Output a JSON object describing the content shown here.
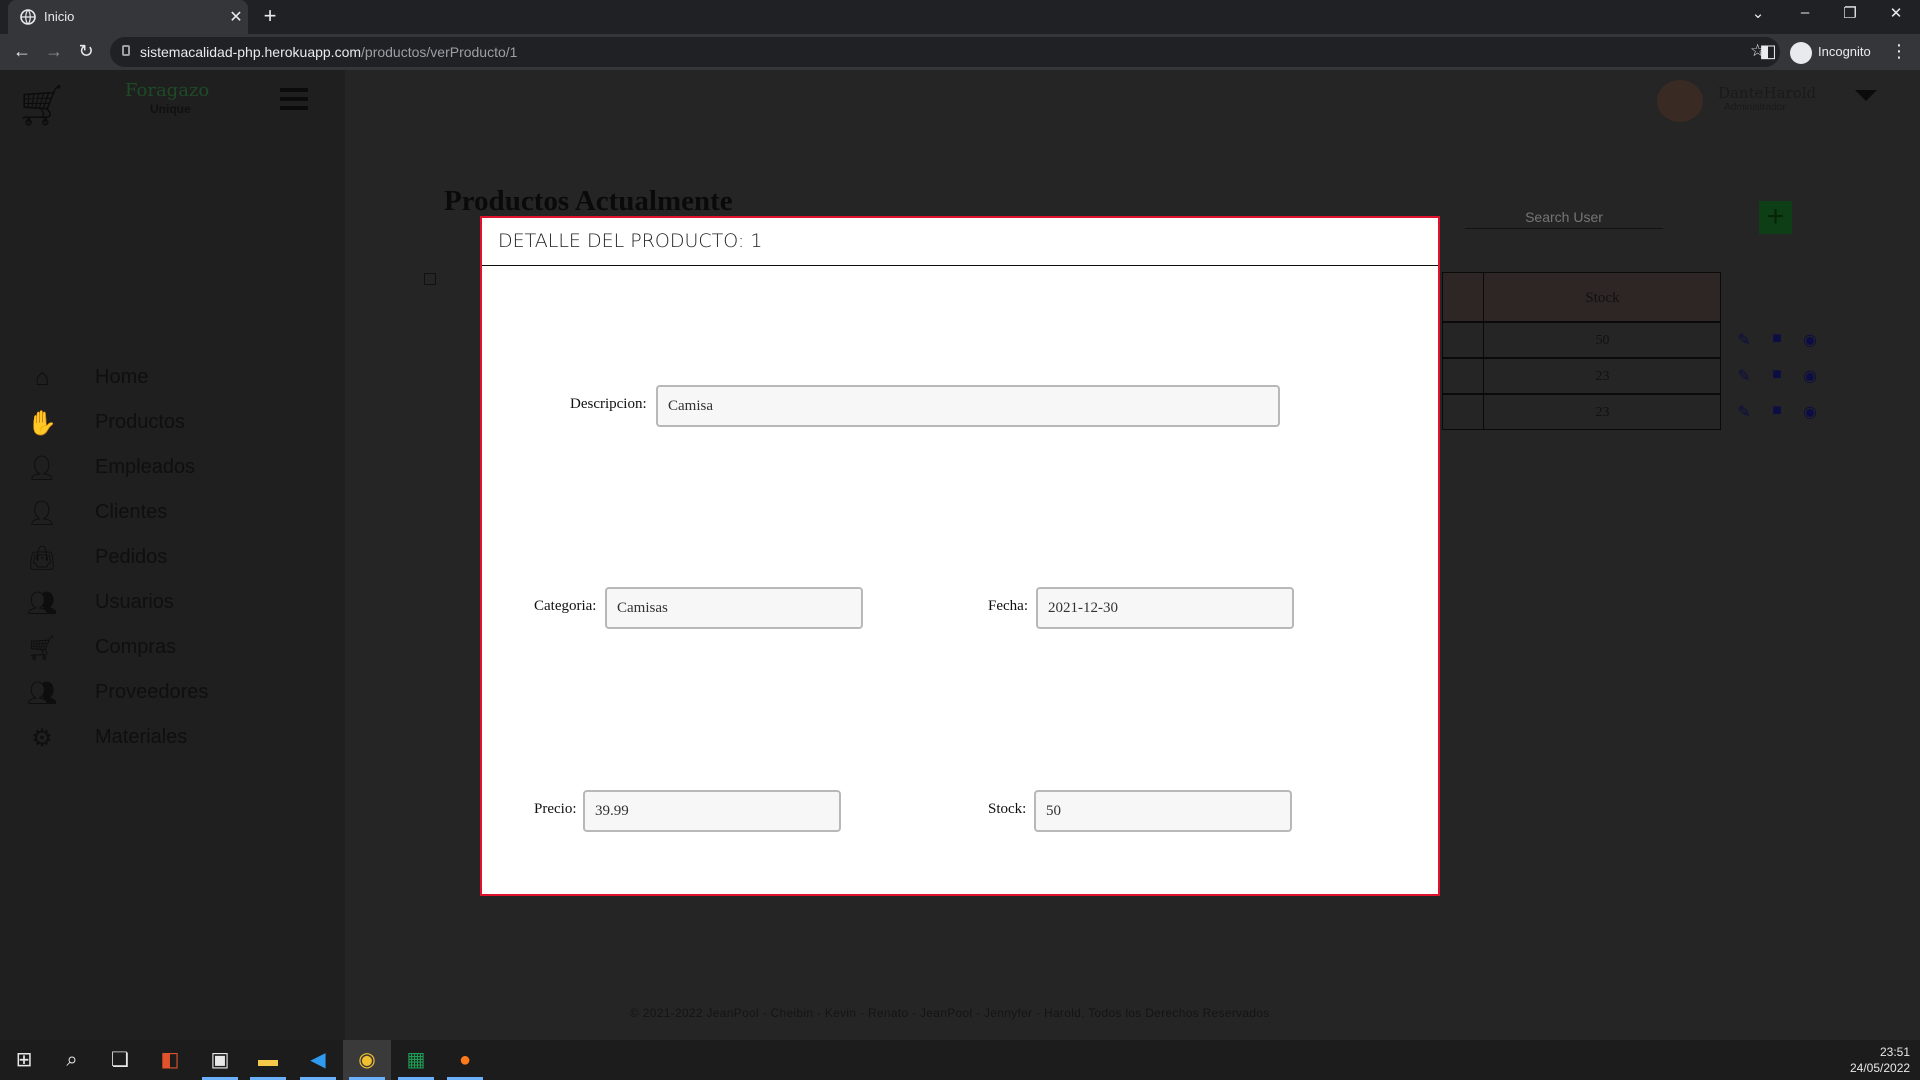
{
  "browser": {
    "tab_title": "Inicio",
    "new_tab": "+",
    "url_host": "sistemacalidad-php.herokuapp.com",
    "url_path": "/productos/verProducto/1",
    "incognito_label": "Incognito"
  },
  "app": {
    "brand": "Foragazo",
    "brand_sub": "Unique",
    "user_name": "DanteHarold",
    "user_role": "Administrador"
  },
  "sidebar": {
    "items": [
      {
        "label": "Home",
        "icon": "home-icon"
      },
      {
        "label": "Productos",
        "icon": "hands-icon"
      },
      {
        "label": "Empleados",
        "icon": "user-check-icon"
      },
      {
        "label": "Clientes",
        "icon": "user-cog-icon"
      },
      {
        "label": "Pedidos",
        "icon": "bag-icon"
      },
      {
        "label": "Usuarios",
        "icon": "users-icon"
      },
      {
        "label": "Compras",
        "icon": "cart-icon"
      },
      {
        "label": "Proveedores",
        "icon": "user-friends-icon"
      },
      {
        "label": "Materiales",
        "icon": "cogs-icon"
      }
    ]
  },
  "main": {
    "title": "Productos Actualmente",
    "search_placeholder": "Search User",
    "add_label": "+",
    "table": {
      "header_stock": "Stock",
      "rows": [
        {
          "stock": "50"
        },
        {
          "stock": "23"
        },
        {
          "stock": "23"
        }
      ]
    },
    "footer": "© 2021-2022 JeanPool - Cheibin - Kevin - Renato - JeanPool - Jennyfer - Harold. Todos los Derechos Reservados"
  },
  "modal": {
    "title": "DETALLE DEL PRODUCTO: 1",
    "descripcion_label": "Descripcion:",
    "descripcion_value": "Camisa",
    "categoria_label": "Categoria:",
    "categoria_value": "Camisas",
    "fecha_label": "Fecha:",
    "fecha_value": "2021-12-30",
    "precio_label": "Precio:",
    "precio_value": "39.99",
    "stock_label": "Stock:",
    "stock_value": "50"
  },
  "taskbar": {
    "time": "23:51",
    "date": "24/05/2022"
  },
  "colors": {
    "modal_border": "#e0112b",
    "add_button": "#0d3e15",
    "page_bg": "#1f1f1f"
  }
}
